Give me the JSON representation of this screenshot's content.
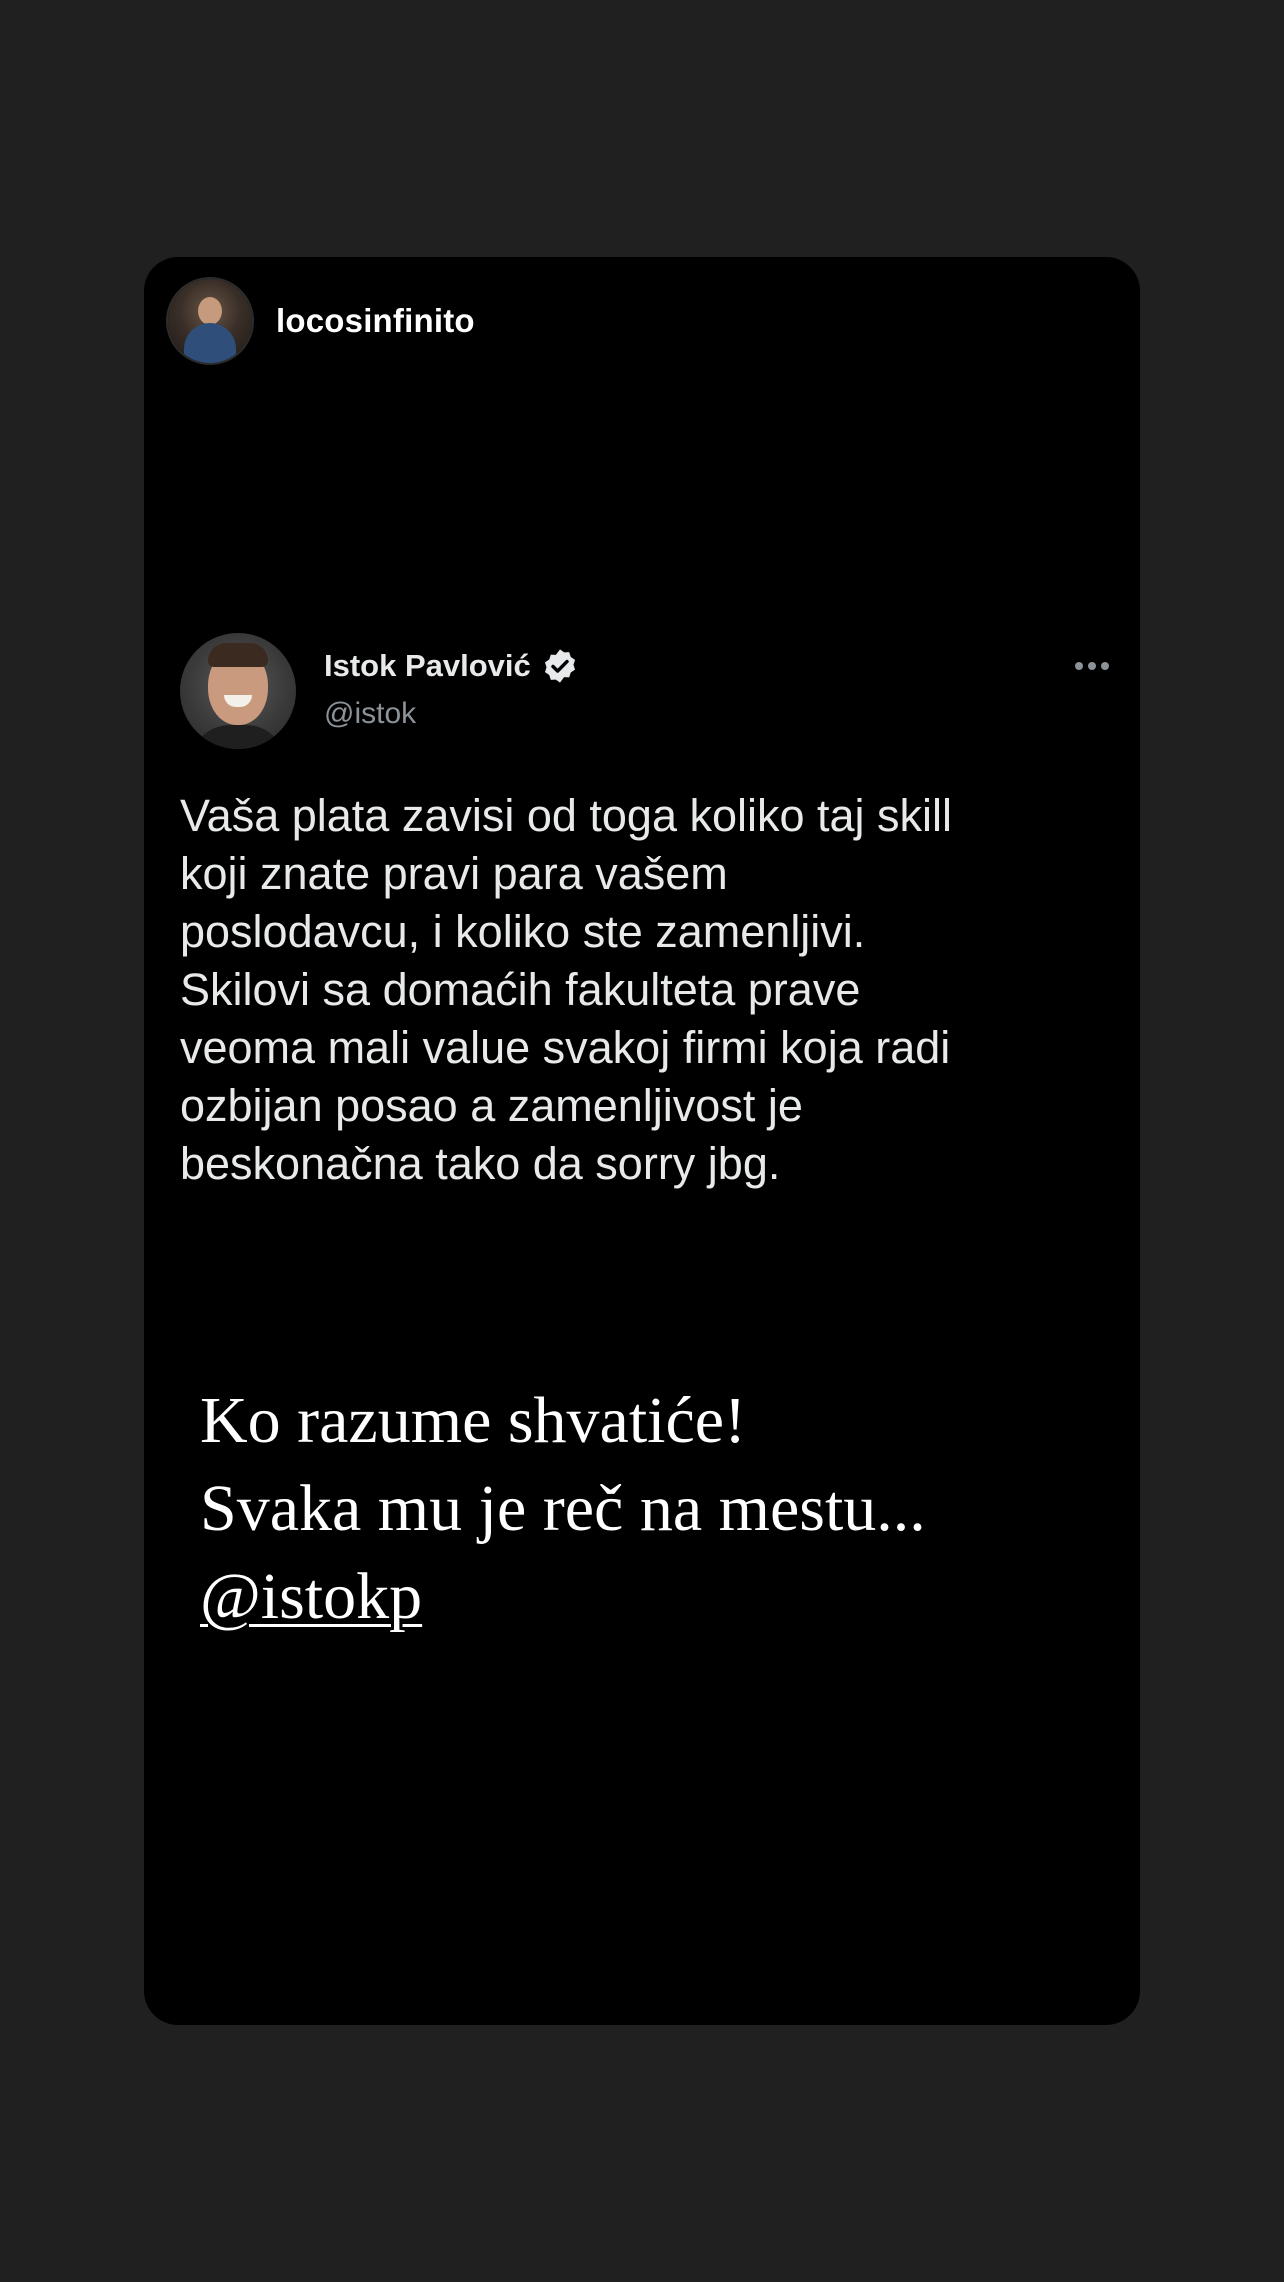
{
  "story": {
    "username": "locosinfinito"
  },
  "tweet": {
    "author_name": "Istok Pavlović",
    "author_handle": "@istok",
    "lines": [
      "Vaša plata zavisi od toga koliko taj skill",
      "koji znate pravi para vašem",
      "poslodavcu, i koliko ste zamenljivi.",
      "Skilovi sa domaćih fakulteta prave",
      "veoma mali value svakoj firmi koja radi",
      "ozbijan posao a zamenljivost je",
      "beskonačna tako da sorry jbg."
    ]
  },
  "caption": {
    "line1": "Ko razume shvatiće!",
    "line2": "Svaka mu je reč na mestu...",
    "mention": "@istokp"
  },
  "icons": {
    "verified": "verified-badge-icon",
    "more": "more-options-icon"
  },
  "colors": {
    "background": "#202020",
    "card": "#000000",
    "text": "#e7e9ea",
    "handle": "#8b9298"
  }
}
